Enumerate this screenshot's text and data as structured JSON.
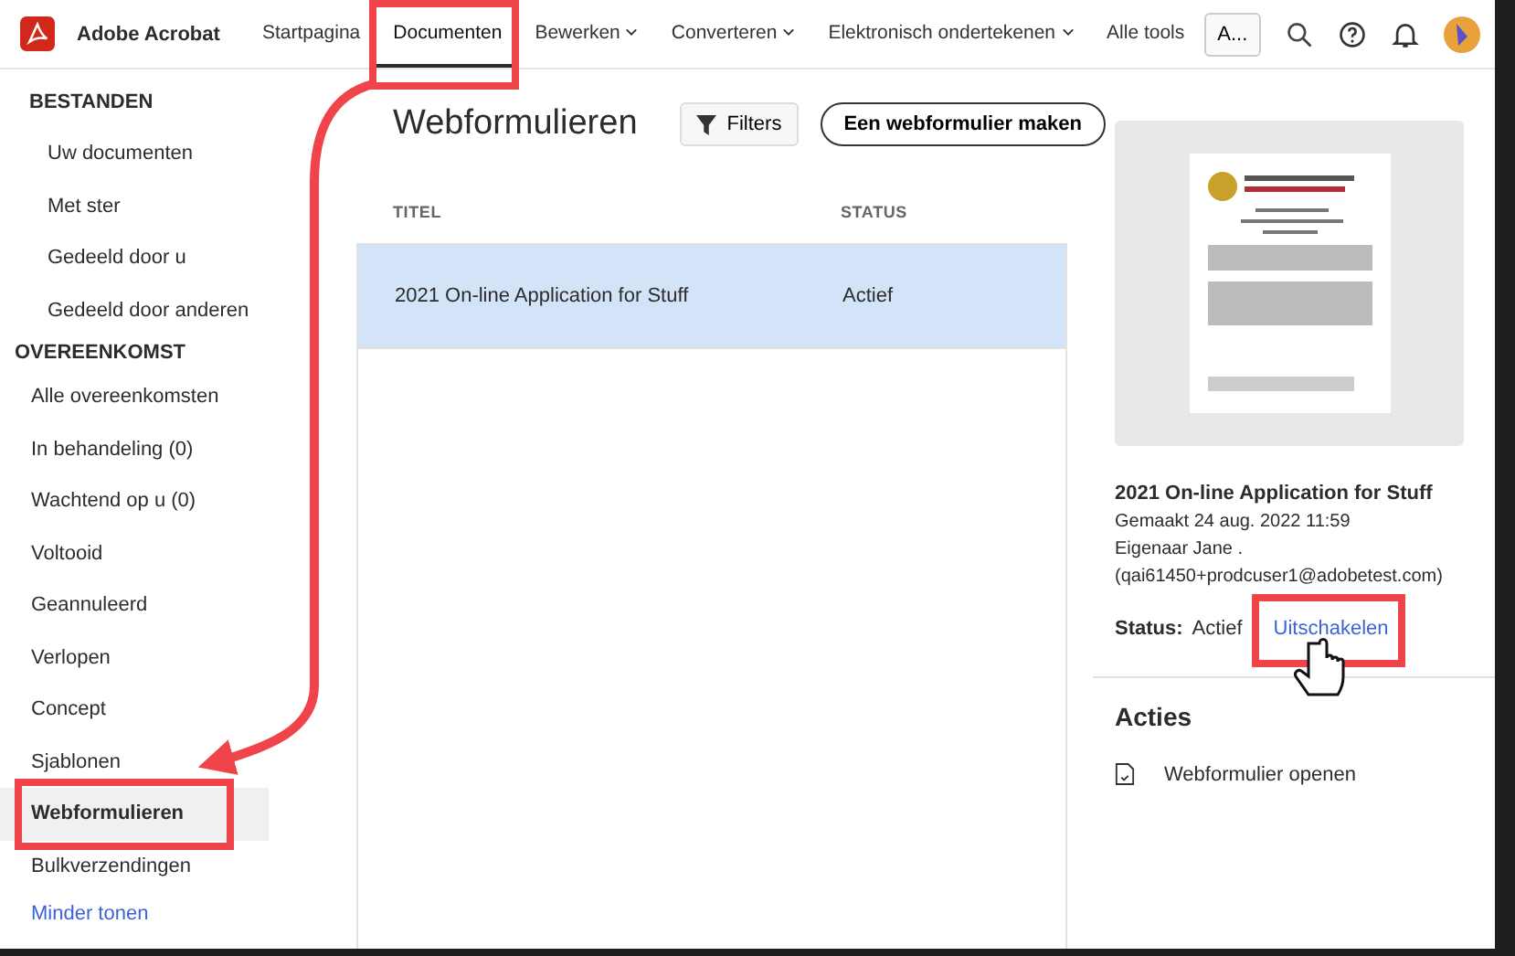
{
  "app": {
    "name": "Adobe Acrobat"
  },
  "nav": [
    {
      "label": "Startpagina",
      "selected": false,
      "has_menu": false
    },
    {
      "label": "Documenten",
      "selected": true,
      "has_menu": false
    },
    {
      "label": "Bewerken",
      "selected": false,
      "has_menu": true
    },
    {
      "label": "Converteren",
      "selected": false,
      "has_menu": true
    },
    {
      "label": "Elektronisch ondertekenen",
      "selected": false,
      "has_menu": true
    },
    {
      "label": "Alle tools",
      "selected": false,
      "has_menu": false
    }
  ],
  "account_button": "A...",
  "sidebar": {
    "sections": [
      {
        "title": "BESTANDEN",
        "indented": true,
        "items": [
          {
            "label": "Uw documenten",
            "selected": false
          },
          {
            "label": "Met ster",
            "selected": false
          },
          {
            "label": "Gedeeld door u",
            "selected": false
          },
          {
            "label": "Gedeeld door anderen",
            "selected": false
          }
        ]
      },
      {
        "title": "OVEREENKOMST",
        "indented": false,
        "items": [
          {
            "label": "Alle overeenkomsten",
            "selected": false
          },
          {
            "label": "In behandeling (0)",
            "selected": false
          },
          {
            "label": "Wachtend op u (0)",
            "selected": false
          },
          {
            "label": "Voltooid",
            "selected": false
          },
          {
            "label": "Geannuleerd",
            "selected": false
          },
          {
            "label": "Verlopen",
            "selected": false
          },
          {
            "label": "Concept",
            "selected": false
          },
          {
            "label": "Sjablonen",
            "selected": false
          },
          {
            "label": "Webformulieren",
            "selected": true
          },
          {
            "label": "Bulkverzendingen",
            "selected": false
          }
        ]
      }
    ],
    "less_link": "Minder tonen"
  },
  "main": {
    "title": "Webformulieren",
    "filters_button": "Filters",
    "create_button": "Een webformulier maken",
    "table": {
      "columns": [
        "TITEL",
        "STATUS"
      ],
      "rows": [
        {
          "title": "2021 On-line Application for Stuff",
          "status": "Actief",
          "selected": true
        }
      ]
    }
  },
  "details": {
    "title": "2021 On-line Application for Stuff",
    "created": "Gemaakt 24 aug. 2022 11:59",
    "owner": "Eigenaar Jane .",
    "email": "(qai61450+prodcuser1@adobetest.com)",
    "status_label": "Status:",
    "status_value": "Actief",
    "disable_link": "Uitschakelen",
    "actions_title": "Acties",
    "actions": [
      "Webformulier openen"
    ]
  }
}
